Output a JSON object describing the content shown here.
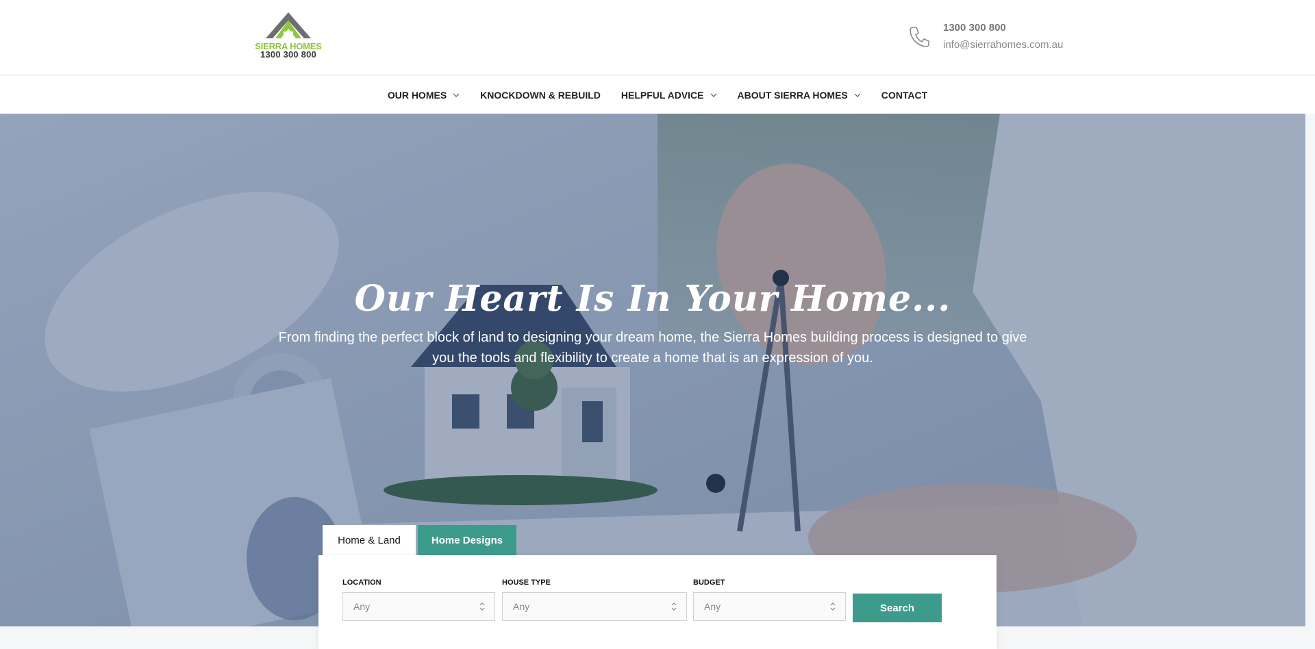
{
  "brand": {
    "logo_name": "SIERRA HOMES",
    "logo_phone": "1300 300 800",
    "green": "#8dc63f",
    "grey": "#6d6e70"
  },
  "contact": {
    "phone": "1300 300 800",
    "email": "info@sierrahomes.com.au",
    "icon": "phone-icon"
  },
  "nav": {
    "items": [
      {
        "label": "OUR HOMES",
        "dropdown": true
      },
      {
        "label": "KNOCKDOWN & REBUILD",
        "dropdown": false
      },
      {
        "label": "HELPFUL ADVICE",
        "dropdown": true
      },
      {
        "label": "ABOUT SIERRA HOMES",
        "dropdown": true
      },
      {
        "label": "CONTACT",
        "dropdown": false
      }
    ]
  },
  "hero": {
    "title": "Our Heart Is In Your Home...",
    "subtitle": "From finding the perfect block of land to designing your dream home, the Sierra Homes building process is designed to give you the tools and flexibility to create a home that is an expression of you."
  },
  "search": {
    "tabs": [
      {
        "label": "Home & Land",
        "active": true
      },
      {
        "label": "Home Designs",
        "active": false
      }
    ],
    "fields": [
      {
        "label": "LOCATION",
        "value": "Any"
      },
      {
        "label": "HOUSE TYPE",
        "value": "Any"
      },
      {
        "label": "BUDGET",
        "value": "Any"
      }
    ],
    "button_label": "Search",
    "accent": "#3d9b8c"
  }
}
